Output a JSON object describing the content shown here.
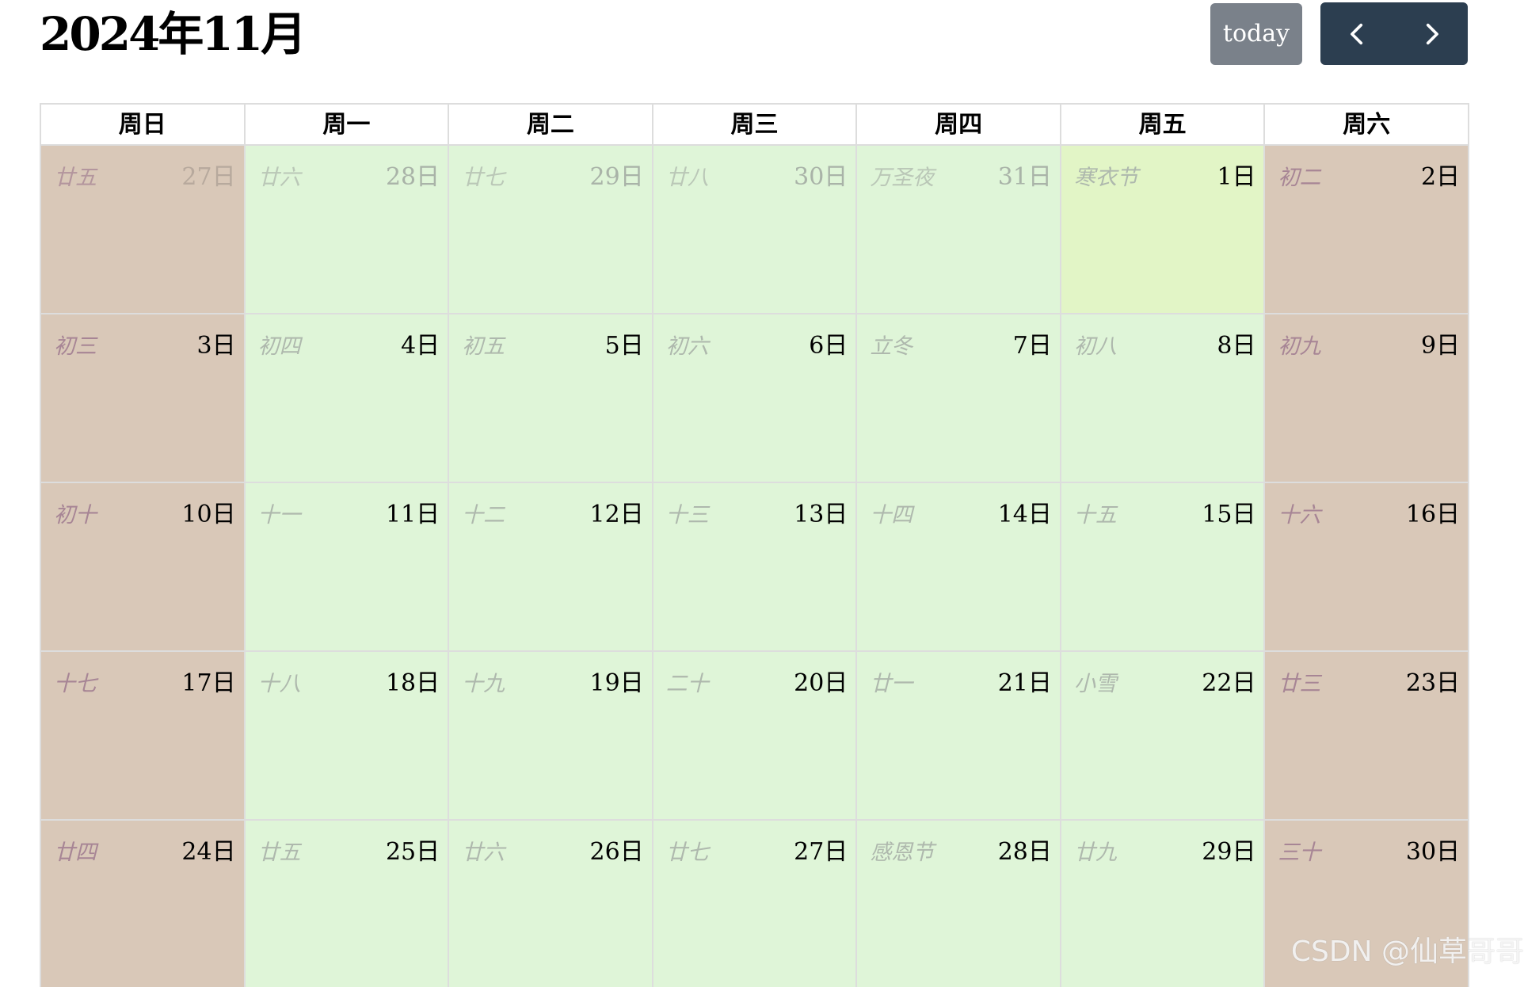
{
  "toolbar": {
    "title": "2024年11月",
    "today_label": "today",
    "prev_icon": "chevron-left-icon",
    "next_icon": "chevron-right-icon",
    "colors": {
      "today_button": "#7a818a",
      "nav_group": "#2c3e50"
    }
  },
  "weekdays": [
    "周日",
    "周一",
    "周二",
    "周三",
    "周四",
    "周五",
    "周六"
  ],
  "colors": {
    "weekday_cell": "#dff5d8",
    "weekend_cell": "#d9c8b8",
    "today_cell": "#e2f5c6",
    "lunar_text": "#aeb8ad",
    "weekend_lunar_text": "#a78595"
  },
  "weeks": [
    [
      {
        "lunar": "廿五",
        "day": "27日",
        "other_month": true,
        "weekend": true
      },
      {
        "lunar": "廿六",
        "day": "28日",
        "other_month": true
      },
      {
        "lunar": "廿七",
        "day": "29日",
        "other_month": true
      },
      {
        "lunar": "廿八",
        "day": "30日",
        "other_month": true
      },
      {
        "lunar": "万圣夜",
        "day": "31日",
        "other_month": true
      },
      {
        "lunar": "寒衣节",
        "day": "1日",
        "today": true
      },
      {
        "lunar": "初二",
        "day": "2日",
        "weekend": true
      }
    ],
    [
      {
        "lunar": "初三",
        "day": "3日",
        "weekend": true
      },
      {
        "lunar": "初四",
        "day": "4日"
      },
      {
        "lunar": "初五",
        "day": "5日"
      },
      {
        "lunar": "初六",
        "day": "6日"
      },
      {
        "lunar": "立冬",
        "day": "7日"
      },
      {
        "lunar": "初八",
        "day": "8日"
      },
      {
        "lunar": "初九",
        "day": "9日",
        "weekend": true
      }
    ],
    [
      {
        "lunar": "初十",
        "day": "10日",
        "weekend": true
      },
      {
        "lunar": "十一",
        "day": "11日"
      },
      {
        "lunar": "十二",
        "day": "12日"
      },
      {
        "lunar": "十三",
        "day": "13日"
      },
      {
        "lunar": "十四",
        "day": "14日"
      },
      {
        "lunar": "十五",
        "day": "15日"
      },
      {
        "lunar": "十六",
        "day": "16日",
        "weekend": true
      }
    ],
    [
      {
        "lunar": "十七",
        "day": "17日",
        "weekend": true
      },
      {
        "lunar": "十八",
        "day": "18日"
      },
      {
        "lunar": "十九",
        "day": "19日"
      },
      {
        "lunar": "二十",
        "day": "20日"
      },
      {
        "lunar": "廿一",
        "day": "21日"
      },
      {
        "lunar": "小雪",
        "day": "22日"
      },
      {
        "lunar": "廿三",
        "day": "23日",
        "weekend": true
      }
    ],
    [
      {
        "lunar": "廿四",
        "day": "24日",
        "weekend": true
      },
      {
        "lunar": "廿五",
        "day": "25日"
      },
      {
        "lunar": "廿六",
        "day": "26日"
      },
      {
        "lunar": "廿七",
        "day": "27日"
      },
      {
        "lunar": "感恩节",
        "day": "28日"
      },
      {
        "lunar": "廿九",
        "day": "29日"
      },
      {
        "lunar": "三十",
        "day": "30日",
        "weekend": true
      }
    ]
  ],
  "watermark": "CSDN @仙草哥哥"
}
